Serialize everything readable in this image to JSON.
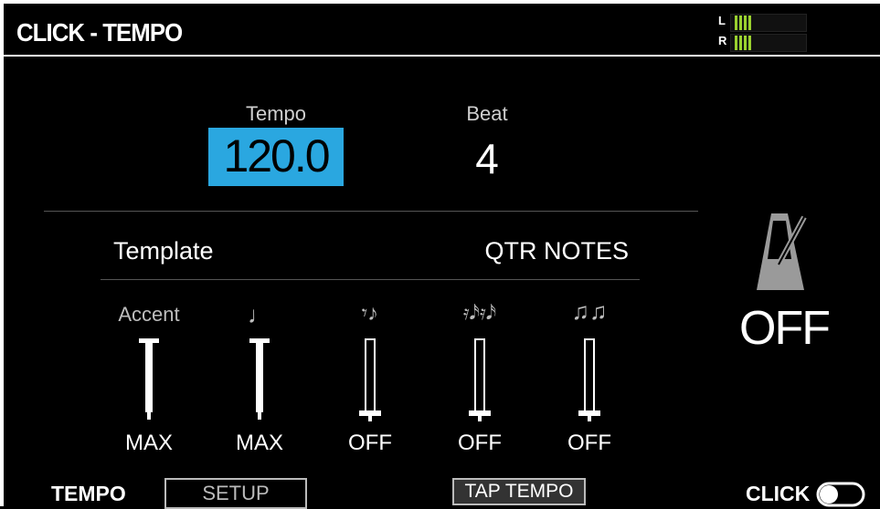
{
  "header": {
    "title": "CLICK - TEMPO",
    "meter_left": "L",
    "meter_right": "R"
  },
  "tempo": {
    "label": "Tempo",
    "value": "120.0"
  },
  "beat": {
    "label": "Beat",
    "value": "4"
  },
  "template": {
    "label": "Template",
    "value": "QTR NOTES"
  },
  "columns": [
    {
      "label": "Accent",
      "value": "MAX",
      "level": 1.0,
      "icon": "accent"
    },
    {
      "label": "♩",
      "value": "MAX",
      "level": 1.0,
      "icon": "quarter-note-icon"
    },
    {
      "label": "𝄾♪",
      "value": "OFF",
      "level": 0.0,
      "icon": "eighth-note-icon"
    },
    {
      "label": "𝄿𝅘𝅥𝅯𝄿𝅘𝅥𝅯",
      "value": "OFF",
      "level": 0.0,
      "icon": "sixteenth-note-icon"
    },
    {
      "label": "♫♫",
      "value": "OFF",
      "level": 0.0,
      "icon": "triplet-icon"
    }
  ],
  "click": {
    "status": "OFF",
    "toggle_label": "CLICK"
  },
  "footer": {
    "mode": "TEMPO",
    "setup": "SETUP",
    "tap_tempo": "TAP TEMPO"
  },
  "colors": {
    "accent": "#2aa7e0",
    "meter": "#9ad12f"
  }
}
